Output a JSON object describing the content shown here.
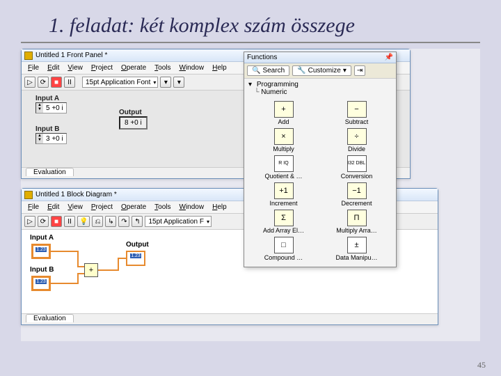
{
  "slide": {
    "title": "1. feladat: két komplex szám összege",
    "page": "45"
  },
  "front_panel": {
    "title": "Untitled 1 Front Panel *",
    "menu": [
      "File",
      "Edit",
      "View",
      "Project",
      "Operate",
      "Tools",
      "Window",
      "Help"
    ],
    "font": "15pt Application Font",
    "inputs": [
      {
        "label": "Input A",
        "value": "5 +0 i"
      },
      {
        "label": "Input B",
        "value": "3 +0 i"
      }
    ],
    "output": {
      "label": "Output",
      "value": "8 +0 i"
    },
    "status_tab": "Evaluation"
  },
  "block_diagram": {
    "title": "Untitled 1 Block Diagram *",
    "menu": [
      "File",
      "Edit",
      "View",
      "Project",
      "Operate",
      "Tools",
      "Window",
      "Help"
    ],
    "font": "15pt Application F",
    "node_a": "Input A",
    "node_b": "Input B",
    "node_out": "Output",
    "term_text": "1.23",
    "add_glyph": "+",
    "status_tab": "Evaluation"
  },
  "functions": {
    "title": "Functions",
    "search": "Search",
    "customize": "Customize",
    "crumb1": "Programming",
    "crumb2": "Numeric",
    "items": [
      {
        "glyph": "+",
        "label": "Add",
        "name": "add"
      },
      {
        "glyph": "−",
        "label": "Subtract",
        "name": "subtract"
      },
      {
        "glyph": "×",
        "label": "Multiply",
        "name": "multiply"
      },
      {
        "glyph": "÷",
        "label": "Divide",
        "name": "divide"
      },
      {
        "glyph": "R\nIQ",
        "label": "Quotient & …",
        "name": "quotient"
      },
      {
        "glyph": "I32\nDBL",
        "label": "Conversion",
        "name": "conversion"
      },
      {
        "glyph": "+1",
        "label": "Increment",
        "name": "increment"
      },
      {
        "glyph": "−1",
        "label": "Decrement",
        "name": "decrement"
      },
      {
        "glyph": "Σ",
        "label": "Add Array El…",
        "name": "add-array"
      },
      {
        "glyph": "Π",
        "label": "Multiply Arra…",
        "name": "mult-array"
      },
      {
        "glyph": "□",
        "label": "Compound …",
        "name": "compound"
      },
      {
        "glyph": "±",
        "label": "Data Manipu…",
        "name": "data-manip"
      }
    ]
  }
}
